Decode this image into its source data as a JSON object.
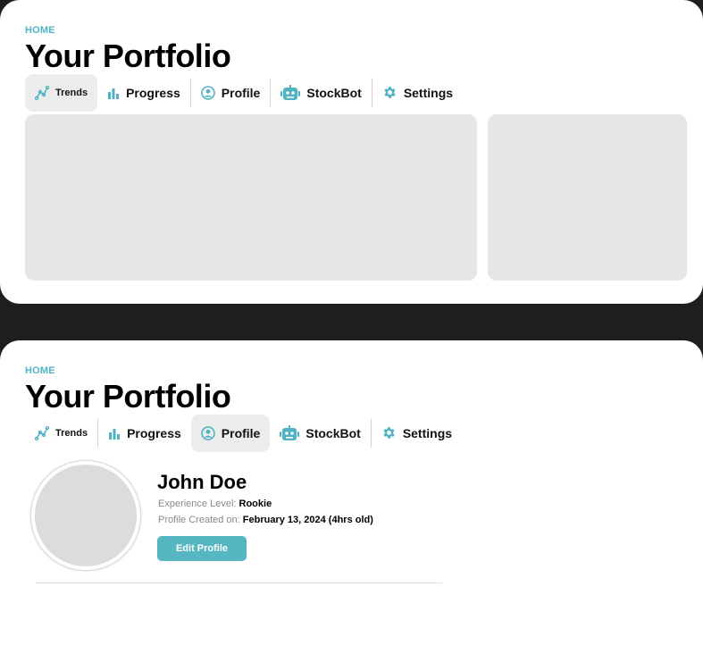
{
  "colors": {
    "accent": "#4fb3c3",
    "button": "#56b6c2",
    "backdrop": "#1e1e1e",
    "panel": "#e6e6e6",
    "active_tab": "#ececec"
  },
  "views": [
    {
      "breadcrumb": "HOME",
      "title": "Your Portfolio",
      "active_tab": "Trends"
    },
    {
      "breadcrumb": "HOME",
      "title": "Your Portfolio",
      "active_tab": "Profile"
    }
  ],
  "tabs": [
    {
      "label": "Trends",
      "icon": "trend-line-icon"
    },
    {
      "label": "Progress",
      "icon": "bar-chart-icon"
    },
    {
      "label": "Profile",
      "icon": "user-circle-icon"
    },
    {
      "label": "StockBot",
      "icon": "robot-icon"
    },
    {
      "label": "Settings",
      "icon": "gear-icon"
    }
  ],
  "profile": {
    "name": "John Doe",
    "experience_label": "Experience Level:",
    "experience_value": "Rookie",
    "created_label": "Profile Created on:",
    "created_value": "February 13, 2024 (4hrs old)",
    "edit_button": "Edit Profile"
  }
}
